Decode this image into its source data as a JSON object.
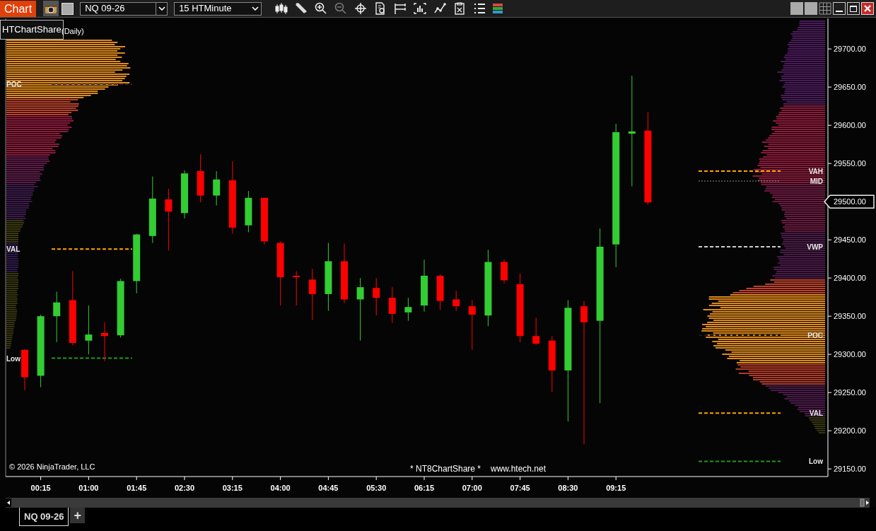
{
  "toolbar": {
    "title": "Chart",
    "instrument": "NQ 09-26",
    "interval": "15 HTMinute"
  },
  "indicator_tooltip": "HTChartShare",
  "indicator_label": "(Daily)",
  "chart": {
    "price_axis": [
      "29700.00",
      "29650.00",
      "29600.00",
      "29550.00",
      "29450.00",
      "29400.00",
      "29350.00",
      "29300.00",
      "29250.00",
      "29200.00",
      "29150.00"
    ],
    "time_axis": [
      "00:15",
      "01:00",
      "01:45",
      "02:30",
      "03:15",
      "04:00",
      "04:45",
      "05:30",
      "06:15",
      "07:00",
      "07:45",
      "08:30",
      "09:15"
    ],
    "left_profile": {
      "levels": [
        {
          "label": "POC"
        },
        {
          "label": "VAL"
        },
        {
          "label": "Low"
        }
      ]
    },
    "right_profile": {
      "levels": [
        {
          "label": "VAH"
        },
        {
          "label": "MID"
        },
        {
          "label": "VWP"
        },
        {
          "label": "POC"
        },
        {
          "label": "VAL"
        },
        {
          "label": "Low"
        }
      ]
    },
    "last_price": "29500.00",
    "copyright": "© 2026 NinjaTrader, LLC",
    "footer_texts": [
      "* NT8ChartShare *",
      "www.htech.net"
    ]
  },
  "tabs": [
    {
      "label": "NQ 09-26",
      "selected": true
    }
  ],
  "add_tab": "+"
}
